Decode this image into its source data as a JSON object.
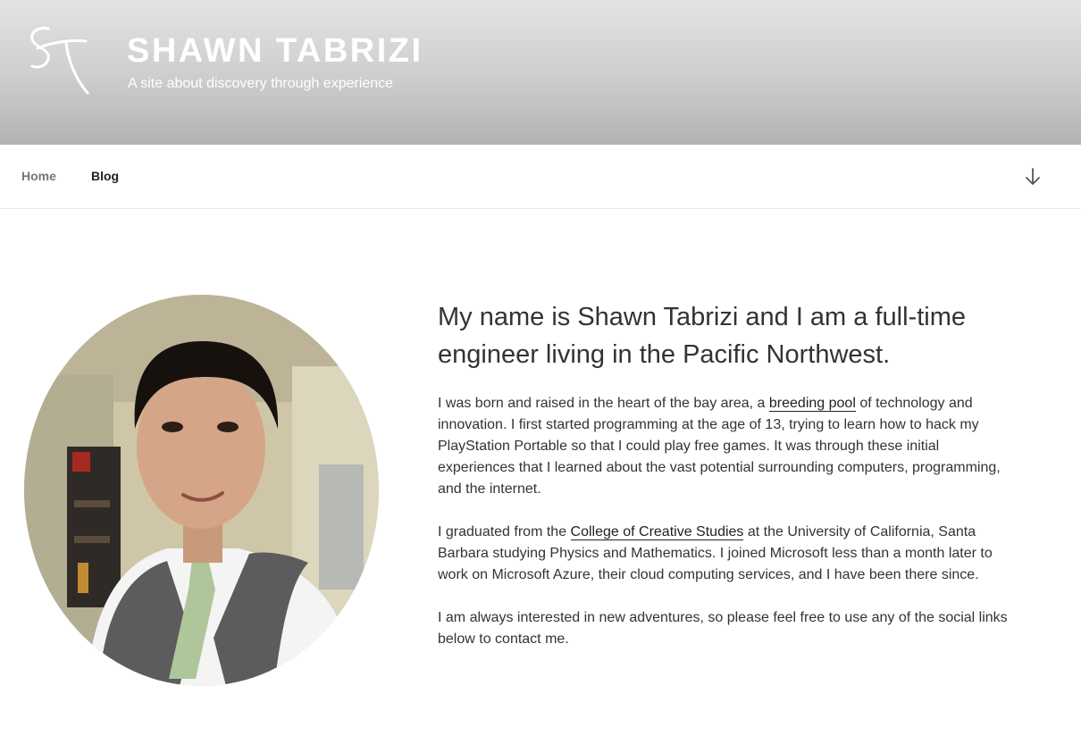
{
  "header": {
    "logo_text": "ST",
    "title": "SHAWN TABRIZI",
    "tagline": "A site about discovery through experience"
  },
  "nav": {
    "items": [
      {
        "label": "Home"
      },
      {
        "label": "Blog"
      }
    ],
    "scroll_icon": "arrow-down-icon"
  },
  "main": {
    "portrait_icon": "profile-photo",
    "headline": "My name is Shawn Tabrizi and I am a full-time engineer living in the Pacific Northwest.",
    "p1": {
      "before": "I was born and raised in the heart of the bay area, a ",
      "link": "breeding pool",
      "after": " of technology and innovation. I first started programming at the age of 13, trying to learn how to hack my PlayStation Portable so that I could play free games. It was through these initial experiences that I learned about the vast potential surrounding computers, programming, and the internet."
    },
    "p2": {
      "before": "I graduated from the ",
      "link": "College of Creative Studies",
      "after": " at the University of California, Santa Barbara studying Physics and Mathematics. I joined Microsoft less than a month later to work on Microsoft Azure, their cloud computing services, and I have been there since."
    },
    "p3": "I am always interested in new adventures, so please feel free to use any of the social links below to contact me."
  },
  "colors": {
    "header_top": "#e3e3e3",
    "header_bottom": "#b3b3b3",
    "text": "#333333",
    "nav_inactive": "#767676"
  }
}
